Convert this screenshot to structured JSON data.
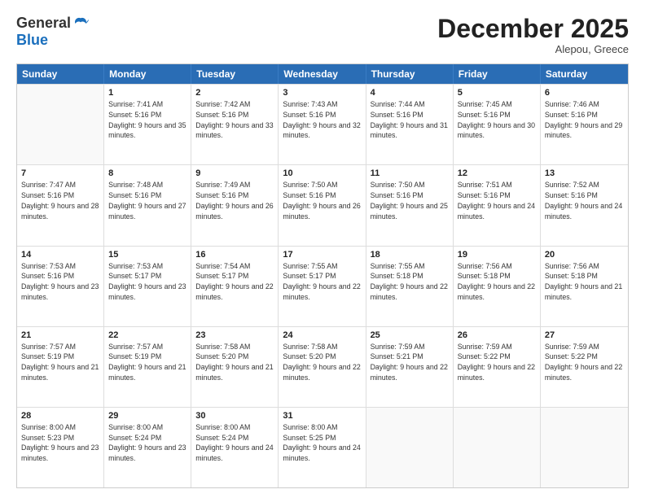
{
  "logo": {
    "general": "General",
    "blue": "Blue"
  },
  "title": "December 2025",
  "subtitle": "Alepou, Greece",
  "days_of_week": [
    "Sunday",
    "Monday",
    "Tuesday",
    "Wednesday",
    "Thursday",
    "Friday",
    "Saturday"
  ],
  "weeks": [
    [
      {
        "day": "",
        "sunrise": "",
        "sunset": "",
        "daylight": "",
        "empty": true
      },
      {
        "day": "1",
        "sunrise": "Sunrise: 7:41 AM",
        "sunset": "Sunset: 5:16 PM",
        "daylight": "Daylight: 9 hours and 35 minutes."
      },
      {
        "day": "2",
        "sunrise": "Sunrise: 7:42 AM",
        "sunset": "Sunset: 5:16 PM",
        "daylight": "Daylight: 9 hours and 33 minutes."
      },
      {
        "day": "3",
        "sunrise": "Sunrise: 7:43 AM",
        "sunset": "Sunset: 5:16 PM",
        "daylight": "Daylight: 9 hours and 32 minutes."
      },
      {
        "day": "4",
        "sunrise": "Sunrise: 7:44 AM",
        "sunset": "Sunset: 5:16 PM",
        "daylight": "Daylight: 9 hours and 31 minutes."
      },
      {
        "day": "5",
        "sunrise": "Sunrise: 7:45 AM",
        "sunset": "Sunset: 5:16 PM",
        "daylight": "Daylight: 9 hours and 30 minutes."
      },
      {
        "day": "6",
        "sunrise": "Sunrise: 7:46 AM",
        "sunset": "Sunset: 5:16 PM",
        "daylight": "Daylight: 9 hours and 29 minutes."
      }
    ],
    [
      {
        "day": "7",
        "sunrise": "Sunrise: 7:47 AM",
        "sunset": "Sunset: 5:16 PM",
        "daylight": "Daylight: 9 hours and 28 minutes."
      },
      {
        "day": "8",
        "sunrise": "Sunrise: 7:48 AM",
        "sunset": "Sunset: 5:16 PM",
        "daylight": "Daylight: 9 hours and 27 minutes."
      },
      {
        "day": "9",
        "sunrise": "Sunrise: 7:49 AM",
        "sunset": "Sunset: 5:16 PM",
        "daylight": "Daylight: 9 hours and 26 minutes."
      },
      {
        "day": "10",
        "sunrise": "Sunrise: 7:50 AM",
        "sunset": "Sunset: 5:16 PM",
        "daylight": "Daylight: 9 hours and 26 minutes."
      },
      {
        "day": "11",
        "sunrise": "Sunrise: 7:50 AM",
        "sunset": "Sunset: 5:16 PM",
        "daylight": "Daylight: 9 hours and 25 minutes."
      },
      {
        "day": "12",
        "sunrise": "Sunrise: 7:51 AM",
        "sunset": "Sunset: 5:16 PM",
        "daylight": "Daylight: 9 hours and 24 minutes."
      },
      {
        "day": "13",
        "sunrise": "Sunrise: 7:52 AM",
        "sunset": "Sunset: 5:16 PM",
        "daylight": "Daylight: 9 hours and 24 minutes."
      }
    ],
    [
      {
        "day": "14",
        "sunrise": "Sunrise: 7:53 AM",
        "sunset": "Sunset: 5:16 PM",
        "daylight": "Daylight: 9 hours and 23 minutes."
      },
      {
        "day": "15",
        "sunrise": "Sunrise: 7:53 AM",
        "sunset": "Sunset: 5:17 PM",
        "daylight": "Daylight: 9 hours and 23 minutes."
      },
      {
        "day": "16",
        "sunrise": "Sunrise: 7:54 AM",
        "sunset": "Sunset: 5:17 PM",
        "daylight": "Daylight: 9 hours and 22 minutes."
      },
      {
        "day": "17",
        "sunrise": "Sunrise: 7:55 AM",
        "sunset": "Sunset: 5:17 PM",
        "daylight": "Daylight: 9 hours and 22 minutes."
      },
      {
        "day": "18",
        "sunrise": "Sunrise: 7:55 AM",
        "sunset": "Sunset: 5:18 PM",
        "daylight": "Daylight: 9 hours and 22 minutes."
      },
      {
        "day": "19",
        "sunrise": "Sunrise: 7:56 AM",
        "sunset": "Sunset: 5:18 PM",
        "daylight": "Daylight: 9 hours and 22 minutes."
      },
      {
        "day": "20",
        "sunrise": "Sunrise: 7:56 AM",
        "sunset": "Sunset: 5:18 PM",
        "daylight": "Daylight: 9 hours and 21 minutes."
      }
    ],
    [
      {
        "day": "21",
        "sunrise": "Sunrise: 7:57 AM",
        "sunset": "Sunset: 5:19 PM",
        "daylight": "Daylight: 9 hours and 21 minutes."
      },
      {
        "day": "22",
        "sunrise": "Sunrise: 7:57 AM",
        "sunset": "Sunset: 5:19 PM",
        "daylight": "Daylight: 9 hours and 21 minutes."
      },
      {
        "day": "23",
        "sunrise": "Sunrise: 7:58 AM",
        "sunset": "Sunset: 5:20 PM",
        "daylight": "Daylight: 9 hours and 21 minutes."
      },
      {
        "day": "24",
        "sunrise": "Sunrise: 7:58 AM",
        "sunset": "Sunset: 5:20 PM",
        "daylight": "Daylight: 9 hours and 22 minutes."
      },
      {
        "day": "25",
        "sunrise": "Sunrise: 7:59 AM",
        "sunset": "Sunset: 5:21 PM",
        "daylight": "Daylight: 9 hours and 22 minutes."
      },
      {
        "day": "26",
        "sunrise": "Sunrise: 7:59 AM",
        "sunset": "Sunset: 5:22 PM",
        "daylight": "Daylight: 9 hours and 22 minutes."
      },
      {
        "day": "27",
        "sunrise": "Sunrise: 7:59 AM",
        "sunset": "Sunset: 5:22 PM",
        "daylight": "Daylight: 9 hours and 22 minutes."
      }
    ],
    [
      {
        "day": "28",
        "sunrise": "Sunrise: 8:00 AM",
        "sunset": "Sunset: 5:23 PM",
        "daylight": "Daylight: 9 hours and 23 minutes."
      },
      {
        "day": "29",
        "sunrise": "Sunrise: 8:00 AM",
        "sunset": "Sunset: 5:24 PM",
        "daylight": "Daylight: 9 hours and 23 minutes."
      },
      {
        "day": "30",
        "sunrise": "Sunrise: 8:00 AM",
        "sunset": "Sunset: 5:24 PM",
        "daylight": "Daylight: 9 hours and 24 minutes."
      },
      {
        "day": "31",
        "sunrise": "Sunrise: 8:00 AM",
        "sunset": "Sunset: 5:25 PM",
        "daylight": "Daylight: 9 hours and 24 minutes."
      },
      {
        "day": "",
        "sunrise": "",
        "sunset": "",
        "daylight": "",
        "empty": true
      },
      {
        "day": "",
        "sunrise": "",
        "sunset": "",
        "daylight": "",
        "empty": true
      },
      {
        "day": "",
        "sunrise": "",
        "sunset": "",
        "daylight": "",
        "empty": true
      }
    ]
  ]
}
